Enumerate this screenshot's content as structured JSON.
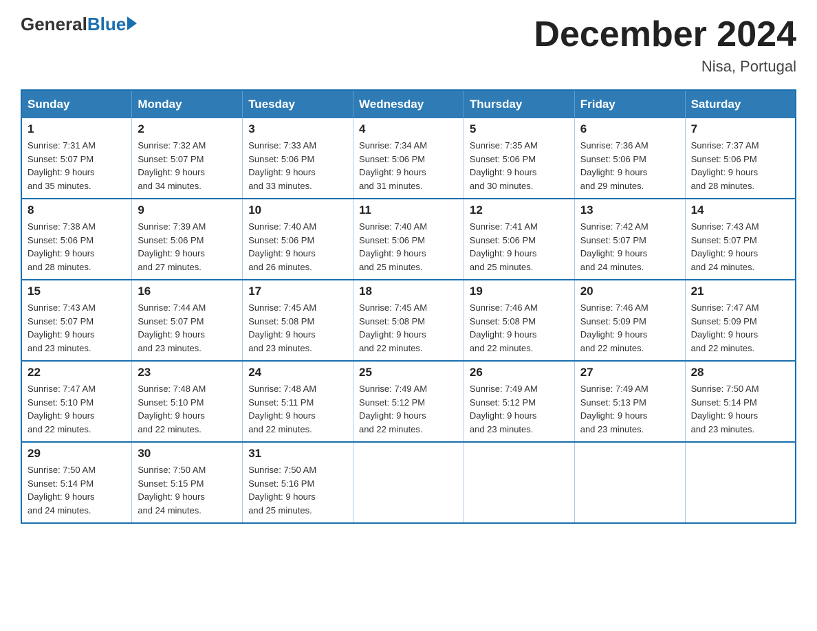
{
  "logo": {
    "general": "General",
    "blue": "Blue"
  },
  "title": {
    "month_year": "December 2024",
    "location": "Nisa, Portugal"
  },
  "weekdays": [
    "Sunday",
    "Monday",
    "Tuesday",
    "Wednesday",
    "Thursday",
    "Friday",
    "Saturday"
  ],
  "weeks": [
    [
      {
        "day": "1",
        "sunrise": "7:31 AM",
        "sunset": "5:07 PM",
        "daylight": "9 hours and 35 minutes."
      },
      {
        "day": "2",
        "sunrise": "7:32 AM",
        "sunset": "5:07 PM",
        "daylight": "9 hours and 34 minutes."
      },
      {
        "day": "3",
        "sunrise": "7:33 AM",
        "sunset": "5:06 PM",
        "daylight": "9 hours and 33 minutes."
      },
      {
        "day": "4",
        "sunrise": "7:34 AM",
        "sunset": "5:06 PM",
        "daylight": "9 hours and 31 minutes."
      },
      {
        "day": "5",
        "sunrise": "7:35 AM",
        "sunset": "5:06 PM",
        "daylight": "9 hours and 30 minutes."
      },
      {
        "day": "6",
        "sunrise": "7:36 AM",
        "sunset": "5:06 PM",
        "daylight": "9 hours and 29 minutes."
      },
      {
        "day": "7",
        "sunrise": "7:37 AM",
        "sunset": "5:06 PM",
        "daylight": "9 hours and 28 minutes."
      }
    ],
    [
      {
        "day": "8",
        "sunrise": "7:38 AM",
        "sunset": "5:06 PM",
        "daylight": "9 hours and 28 minutes."
      },
      {
        "day": "9",
        "sunrise": "7:39 AM",
        "sunset": "5:06 PM",
        "daylight": "9 hours and 27 minutes."
      },
      {
        "day": "10",
        "sunrise": "7:40 AM",
        "sunset": "5:06 PM",
        "daylight": "9 hours and 26 minutes."
      },
      {
        "day": "11",
        "sunrise": "7:40 AM",
        "sunset": "5:06 PM",
        "daylight": "9 hours and 25 minutes."
      },
      {
        "day": "12",
        "sunrise": "7:41 AM",
        "sunset": "5:06 PM",
        "daylight": "9 hours and 25 minutes."
      },
      {
        "day": "13",
        "sunrise": "7:42 AM",
        "sunset": "5:07 PM",
        "daylight": "9 hours and 24 minutes."
      },
      {
        "day": "14",
        "sunrise": "7:43 AM",
        "sunset": "5:07 PM",
        "daylight": "9 hours and 24 minutes."
      }
    ],
    [
      {
        "day": "15",
        "sunrise": "7:43 AM",
        "sunset": "5:07 PM",
        "daylight": "9 hours and 23 minutes."
      },
      {
        "day": "16",
        "sunrise": "7:44 AM",
        "sunset": "5:07 PM",
        "daylight": "9 hours and 23 minutes."
      },
      {
        "day": "17",
        "sunrise": "7:45 AM",
        "sunset": "5:08 PM",
        "daylight": "9 hours and 23 minutes."
      },
      {
        "day": "18",
        "sunrise": "7:45 AM",
        "sunset": "5:08 PM",
        "daylight": "9 hours and 22 minutes."
      },
      {
        "day": "19",
        "sunrise": "7:46 AM",
        "sunset": "5:08 PM",
        "daylight": "9 hours and 22 minutes."
      },
      {
        "day": "20",
        "sunrise": "7:46 AM",
        "sunset": "5:09 PM",
        "daylight": "9 hours and 22 minutes."
      },
      {
        "day": "21",
        "sunrise": "7:47 AM",
        "sunset": "5:09 PM",
        "daylight": "9 hours and 22 minutes."
      }
    ],
    [
      {
        "day": "22",
        "sunrise": "7:47 AM",
        "sunset": "5:10 PM",
        "daylight": "9 hours and 22 minutes."
      },
      {
        "day": "23",
        "sunrise": "7:48 AM",
        "sunset": "5:10 PM",
        "daylight": "9 hours and 22 minutes."
      },
      {
        "day": "24",
        "sunrise": "7:48 AM",
        "sunset": "5:11 PM",
        "daylight": "9 hours and 22 minutes."
      },
      {
        "day": "25",
        "sunrise": "7:49 AM",
        "sunset": "5:12 PM",
        "daylight": "9 hours and 22 minutes."
      },
      {
        "day": "26",
        "sunrise": "7:49 AM",
        "sunset": "5:12 PM",
        "daylight": "9 hours and 23 minutes."
      },
      {
        "day": "27",
        "sunrise": "7:49 AM",
        "sunset": "5:13 PM",
        "daylight": "9 hours and 23 minutes."
      },
      {
        "day": "28",
        "sunrise": "7:50 AM",
        "sunset": "5:14 PM",
        "daylight": "9 hours and 23 minutes."
      }
    ],
    [
      {
        "day": "29",
        "sunrise": "7:50 AM",
        "sunset": "5:14 PM",
        "daylight": "9 hours and 24 minutes."
      },
      {
        "day": "30",
        "sunrise": "7:50 AM",
        "sunset": "5:15 PM",
        "daylight": "9 hours and 24 minutes."
      },
      {
        "day": "31",
        "sunrise": "7:50 AM",
        "sunset": "5:16 PM",
        "daylight": "9 hours and 25 minutes."
      },
      null,
      null,
      null,
      null
    ]
  ],
  "labels": {
    "sunrise": "Sunrise:",
    "sunset": "Sunset:",
    "daylight": "Daylight:"
  }
}
